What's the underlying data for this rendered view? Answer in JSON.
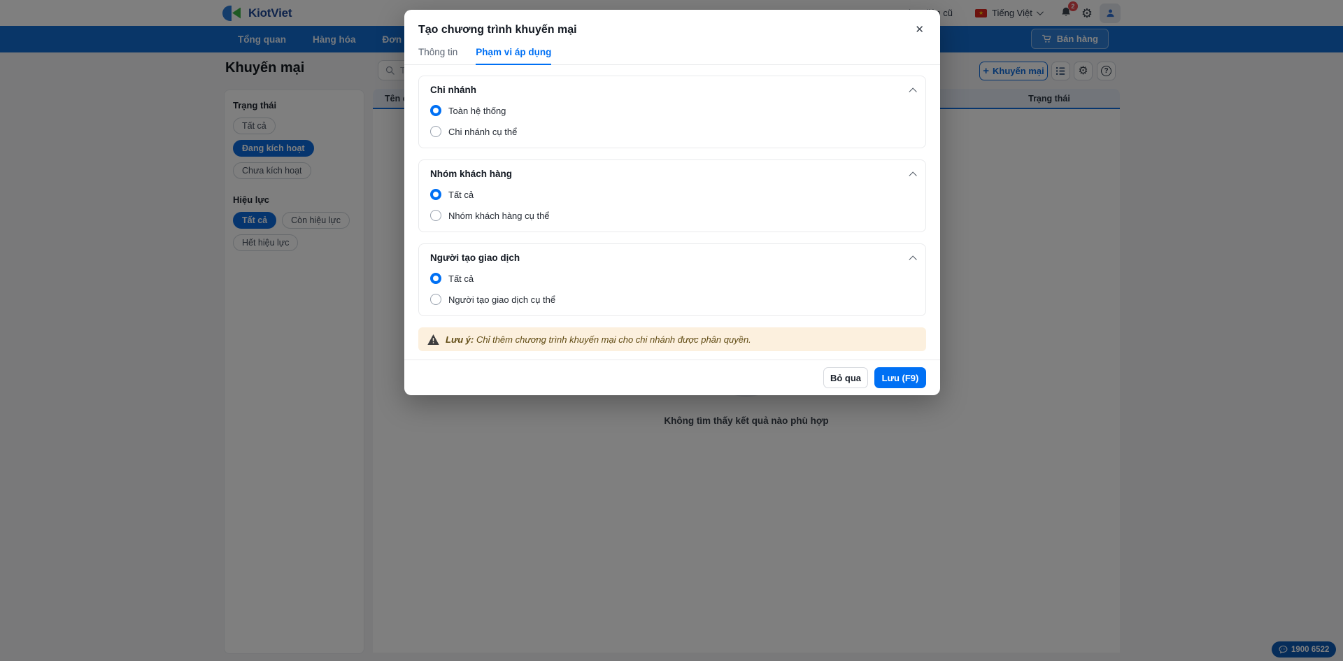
{
  "header": {
    "brand": "KiotViet",
    "old_ui_link": "Giao diện cũ",
    "language": "Tiếng Việt",
    "notification_count": "2"
  },
  "nav": {
    "items": [
      {
        "label": "Tổng quan"
      },
      {
        "label": "Hàng hóa"
      },
      {
        "label": "Đơn hàng"
      }
    ],
    "sell_button": "Bán hàng"
  },
  "page": {
    "title": "Khuyến mại",
    "search_placeholder": "Theo mã, tên chương trình",
    "add_button": "Khuyến mại",
    "filters": {
      "status": {
        "label": "Trạng thái",
        "options": [
          {
            "label": "Tất cả",
            "active": false
          },
          {
            "label": "Đang kích hoạt",
            "active": true
          },
          {
            "label": "Chưa kích hoạt",
            "active": false
          }
        ]
      },
      "validity": {
        "label": "Hiệu lực",
        "options": [
          {
            "label": "Tất cả",
            "active": true
          },
          {
            "label": "Còn hiệu lực",
            "active": false
          },
          {
            "label": "Hết hiệu lực",
            "active": false
          }
        ]
      }
    },
    "table": {
      "columns": [
        "Tên chương trình",
        "Trạng thái"
      ]
    },
    "empty_text": "Không tìm thấy kết quả nào phù hợp"
  },
  "modal": {
    "title": "Tạo chương trình khuyến mại",
    "tabs": [
      {
        "label": "Thông tin",
        "active": false
      },
      {
        "label": "Phạm vi áp dụng",
        "active": true
      }
    ],
    "sections": [
      {
        "title": "Chi nhánh",
        "options": [
          {
            "label": "Toàn hệ thống",
            "selected": true
          },
          {
            "label": "Chi nhánh cụ thể",
            "selected": false
          }
        ]
      },
      {
        "title": "Nhóm khách hàng",
        "options": [
          {
            "label": "Tất cả",
            "selected": true
          },
          {
            "label": "Nhóm khách hàng cụ thể",
            "selected": false
          }
        ]
      },
      {
        "title": "Người tạo giao dịch",
        "options": [
          {
            "label": "Tất cả",
            "selected": true
          },
          {
            "label": "Người tạo giao dịch cụ thể",
            "selected": false
          }
        ]
      }
    ],
    "warning": {
      "prefix": "Lưu ý:",
      "text": "Chỉ thêm chương trình khuyến mại cho chi nhánh được phân quyền."
    },
    "cancel_button": "Bỏ qua",
    "save_button": "Lưu (F9)"
  },
  "support": {
    "phone": "1900 6522"
  },
  "icons": {
    "plus": "+",
    "close": "✕",
    "star": "★",
    "gear": "⚙",
    "help": "?"
  },
  "colors": {
    "accent": "#0070f4",
    "nav_bar": "#126dd1",
    "brand_navy": "#1d4796",
    "brand_green": "#3eb549",
    "filter_active": "#0d6bdd",
    "table_header_bg": "#e4eaf4",
    "warning_bg": "#fcf0de",
    "warning_text": "#5f4a12",
    "badge_red": "#e5484d"
  }
}
